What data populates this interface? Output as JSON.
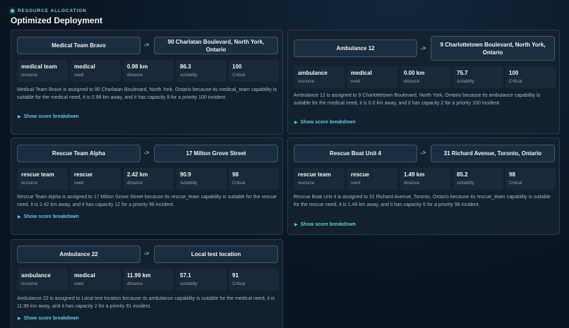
{
  "header": {
    "eyebrow": "RESOURCE ALLOCATION",
    "title": "Optimized Deployment"
  },
  "colors": {
    "accent": "#5bc9dc",
    "card_bg": "#142230",
    "stat_bg": "#1a2939"
  },
  "labels": {
    "resource": "resource",
    "need": "need",
    "distance": "distance",
    "suitability": "suitability",
    "arrow": "->",
    "toggle": "Show score breakdown"
  },
  "deployments": [
    {
      "resource_name": "Medical Team Bravo",
      "location": "90 Charlatan Boulevard, North York, Ontario",
      "resource_type": "medical team",
      "need": "medical",
      "distance": "0.98 km",
      "suitability": "86.3",
      "priority": "100",
      "priority_label": "Critical",
      "description": "Medical Team Bravo is assigned to 90 Charlatan Boulevard, North York, Ontario because its medical_team capability is suitable for the medical need, it is 0.98 km away, and it has capacity 8 for a priority 100 incident."
    },
    {
      "resource_name": "Ambulance 12",
      "location": "9 Charlottetown Boulevard, North York, Ontario",
      "resource_type": "ambulance",
      "need": "medical",
      "distance": "0.00 km",
      "suitability": "75.7",
      "priority": "100",
      "priority_label": "Critical",
      "description": "Ambulance 12 is assigned to 9 Charlottetown Boulevard, North York, Ontario because its ambulance capability is suitable for the medical need, it is 0.0 km away, and it has capacity 2 for a priority 100 incident."
    },
    {
      "resource_name": "Rescue Team Alpha",
      "location": "17 Milton Grove Street",
      "resource_type": "rescue team",
      "need": "rescue",
      "distance": "2.42 km",
      "suitability": "90.9",
      "priority": "98",
      "priority_label": "Critical",
      "description": "Rescue Team Alpha is assigned to 17 Milton Grove Street because its rescue_team capability is suitable for the rescue need, it is 2.42 km away, and it has capacity 12 for a priority 98 incident."
    },
    {
      "resource_name": "Rescue Boat Unit 4",
      "location": "31 Richard Avenue, Toronto, Ontario",
      "resource_type": "rescue team",
      "need": "rescue",
      "distance": "1.49 km",
      "suitability": "85.2",
      "priority": "98",
      "priority_label": "Critical",
      "description": "Rescue Boat Unit 4 is assigned to 31 Richard Avenue, Toronto, Ontario because its rescue_team capability is suitable for the rescue need, it is 1.49 km away, and it has capacity 6 for a priority 98 incident."
    },
    {
      "resource_name": "Ambulance 22",
      "location": "Local test location",
      "resource_type": "ambulance",
      "need": "medical",
      "distance": "11.99 km",
      "suitability": "57.1",
      "priority": "91",
      "priority_label": "Critical",
      "description": "Ambulance 22 is assigned to Local test location because its ambulance capability is suitable for the medical need, it is 11.99 km away, and it has capacity 2 for a priority 91 incident."
    }
  ]
}
